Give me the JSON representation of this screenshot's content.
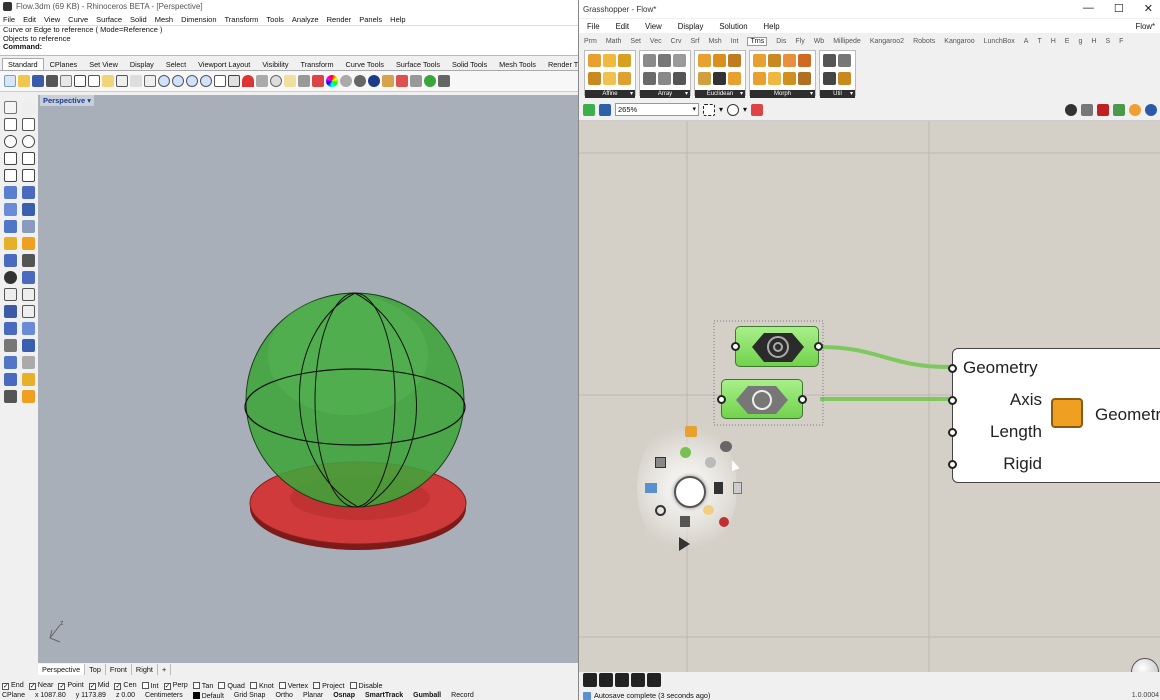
{
  "rhino": {
    "title": "Flow.3dm (69 KB) - Rhinoceros BETA - [Perspective]",
    "menu": [
      "File",
      "Edit",
      "View",
      "Curve",
      "Surface",
      "Solid",
      "Mesh",
      "Dimension",
      "Transform",
      "Tools",
      "Analyze",
      "Render",
      "Panels",
      "Help"
    ],
    "command_history": [
      "Curve or Edge to reference ( Mode=Reference )",
      "Objects to reference"
    ],
    "command_prompt": "Command:",
    "toolbar_tabs": [
      "Standard",
      "CPlanes",
      "Set View",
      "Display",
      "Select",
      "Viewport Layout",
      "Visibility",
      "Transform",
      "Curve Tools",
      "Surface Tools",
      "Solid Tools",
      "Mesh Tools",
      "Render T"
    ],
    "active_tab": "Standard",
    "viewport_label": "Perspective",
    "viewport_tabs": [
      "Perspective",
      "Top",
      "Front",
      "Right",
      "+"
    ],
    "osnaps": [
      {
        "label": "End",
        "checked": true
      },
      {
        "label": "Near",
        "checked": true
      },
      {
        "label": "Point",
        "checked": true
      },
      {
        "label": "Mid",
        "checked": true
      },
      {
        "label": "Cen",
        "checked": true
      },
      {
        "label": "Int",
        "checked": false
      },
      {
        "label": "Perp",
        "checked": true
      },
      {
        "label": "Tan",
        "checked": false
      },
      {
        "label": "Quad",
        "checked": false
      },
      {
        "label": "Knot",
        "checked": false
      },
      {
        "label": "Vertex",
        "checked": false
      },
      {
        "label": "Project",
        "checked": false
      },
      {
        "label": "Disable",
        "checked": false
      }
    ],
    "status": {
      "cplane": "CPlane",
      "x": "x 1087.80",
      "y": "y 1173.89",
      "z": "z 0.00",
      "units": "Centimeters",
      "layer": "Default",
      "toggles": [
        "Grid Snap",
        "Ortho",
        "Planar",
        "Osnap",
        "SmartTrack",
        "Gumball",
        "Record"
      ]
    }
  },
  "grasshopper": {
    "title": "Grasshopper - Flow*",
    "window_buttons": [
      "—",
      "☐",
      "✕"
    ],
    "menu": [
      "File",
      "Edit",
      "View",
      "Display",
      "Solution",
      "Help"
    ],
    "document_name": "Flow*",
    "tabs": [
      "Prm",
      "Math",
      "Set",
      "Vec",
      "Crv",
      "Srf",
      "Msh",
      "Int",
      "Trns",
      "Dis",
      "Fly",
      "Wb",
      "Millipede",
      "Kangaroo2",
      "Robots",
      "Kangaroo",
      "LunchBox",
      "A",
      "T",
      "H",
      "E",
      "g",
      "H",
      "S",
      "F"
    ],
    "active_tab": "Trns",
    "groups": [
      "Affine",
      "Array",
      "Euclidean",
      "Morph",
      "Util"
    ],
    "zoom": "265%",
    "component": {
      "inputs": [
        "Geometry",
        "Axis",
        "Length",
        "Rigid"
      ],
      "output_label": "Geometr"
    },
    "status_message": "Autosave complete (3 seconds ago)",
    "version": "1.0.0004"
  },
  "colors": {
    "sphere": "#3da53a",
    "disc": "#d33a3a",
    "component_green": "#8be46a",
    "viewport_bg": "#a8afb8",
    "canvas_bg": "#d4d0c8"
  }
}
